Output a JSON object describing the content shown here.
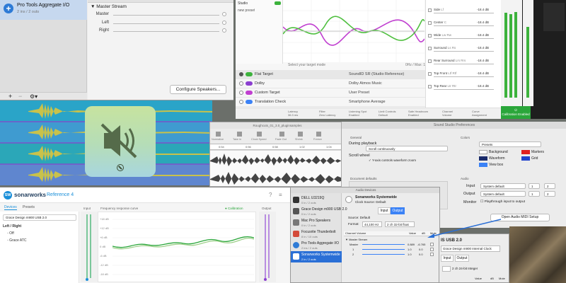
{
  "aggregate_io": {
    "device_name": "Pro Tools Aggregate I/O",
    "device_sub": "2 ins / 2 outs",
    "section": "Master Stream",
    "channels": [
      "Master",
      "Left",
      "Right"
    ],
    "configure_label": "Configure Speakers..."
  },
  "soundid": {
    "top_label": "Studio",
    "new_preset": "new preset",
    "select_mode": "Select your target mode",
    "range_label": "0Hz / Max: 100",
    "targets": [
      {
        "name": "Flat Target",
        "desc": "SoundID SR (Studio Reference)",
        "color": "#3cb23c"
      },
      {
        "name": "Dolby",
        "desc": "Dolby Atmos Music",
        "color": "#8b3fd0"
      },
      {
        "name": "Custom Target",
        "desc": "User Preset",
        "color": "#c03fd0"
      },
      {
        "name": "Translation Check",
        "desc": "Smartphone Average",
        "color": "#3b82f6"
      }
    ],
    "footer": [
      {
        "label": "Latency",
        "value": "36.3 ms"
      },
      {
        "label": "Filter",
        "value": "Zero Latency"
      },
      {
        "label": "Listening Spot",
        "value": "Enabled"
      },
      {
        "label": "Limit Controls",
        "value": "Default"
      },
      {
        "label": "Safe Headroom",
        "value": "Enabled"
      },
      {
        "label": "Channel",
        "value": "Volume"
      },
      {
        "label": "Curve",
        "value": "Assignment"
      }
    ],
    "channels": [
      {
        "name": "Side",
        "tag": "Lf",
        "value": "-18.4 dB"
      },
      {
        "name": "Center",
        "tag": "C",
        "value": "-18.4 dB"
      },
      {
        "name": "Wide",
        "tag": "Lw Rw",
        "value": "-18.4 dB"
      },
      {
        "name": "Surround",
        "tag": "Ls Rs",
        "value": "-18.4 dB"
      },
      {
        "name": "Rear Surround",
        "tag": "Lrs Rrs",
        "value": "-18.4 dB"
      },
      {
        "name": "Top Front",
        "tag": "Ltf Rtf",
        "value": "-18.4 dB"
      },
      {
        "name": "Top Rear",
        "tag": "Ltr Rtr",
        "value": "-18.4 dB"
      }
    ],
    "calibration": "Calibration Enabled"
  },
  "pro_tools": {
    "title": "Roughcuts_01_3.0_pluginsamples",
    "tools": [
      "Normalize",
      "Take in",
      "Clock Speed",
      "Fade Out",
      "Shrink",
      "Freeze"
    ],
    "ruler": [
      "0:54",
      "0:56",
      "0:58",
      "1:02",
      "1:04"
    ]
  },
  "preferences": {
    "title": "Sound Studio Preferences",
    "general": "General",
    "during_playback": "During playback",
    "scroll_option": "Scroll continuously",
    "scroll_wheel": "Scroll wheel",
    "zoom_check": "Y-axis controls waveform zoom",
    "document_defaults": "Document defaults",
    "colors": "Colors",
    "presets": "Presets",
    "swatches": [
      {
        "label": "Background",
        "color": "#ffffff"
      },
      {
        "label": "Markers",
        "color": "#e02020"
      },
      {
        "label": "Waveform",
        "color": "#1a2b6a"
      },
      {
        "label": "Grid",
        "color": "#2244cc"
      },
      {
        "label": "View box",
        "color": "#3b82f6"
      }
    ],
    "audio": "Audio",
    "input_label": "Input",
    "input_value": "System default",
    "output_label": "Output",
    "output_value": "System default",
    "monitor_label": "Monitor",
    "monitor_check": "Playthrough input to output",
    "ch1": "1",
    "ch2": "2",
    "midi_button": "Open Audio MIDI Setup"
  },
  "sonarworks": {
    "brand": "sonarworks",
    "product": "Reference 4",
    "tabs": [
      "Devices",
      "Presets"
    ],
    "device_select": "Grace Design m900 USB 2.0",
    "section": "Left / Right",
    "items": [
      "Off",
      "Grace ATC"
    ],
    "input_label": "Input",
    "plot_label": "Frequency response curve",
    "calibration": "Calibration",
    "output_label": "Output",
    "db_ticks": [
      "+18 dB",
      "+12 dB",
      "+6 dB",
      "0 dB",
      "-6 dB",
      "-12 dB",
      "-18 dB"
    ]
  },
  "audio_devices": {
    "title": "Audio Devices",
    "devices": [
      {
        "name": "DELL U3219Q",
        "sub": "0 in / 2 outs"
      },
      {
        "name": "Grace Design m900 USB 2.0",
        "sub": "0 in / 2 outs"
      },
      {
        "name": "Mac Pro Speakers",
        "sub": "0 in / 2 outs"
      },
      {
        "name": "Focusrite Thunderbolt",
        "sub": "8 in / 10 outs"
      },
      {
        "name": "Pro Tools Aggregate I/O",
        "sub": "2 ins / 2 outs"
      },
      {
        "name": "Sonarworks Systemwide",
        "sub": "2 in / 2 outs"
      }
    ],
    "selected_name": "Sonarworks Systemwide",
    "clock_source": "Clock Source:  Default",
    "tab_input": "Input",
    "tab_output": "Output",
    "source_line": "Source:  Default",
    "format_label": "Format:",
    "format_rate": "44,100 Hz",
    "format_bits": "2 ch 32-bit float",
    "col_headers": [
      "Channel Volume",
      "Value",
      "dB",
      "Mute"
    ],
    "master_stream": "Master Stream",
    "rows": [
      {
        "name": "Master",
        "value": "0.889",
        "db": "-6.765"
      },
      {
        "name": "1",
        "value": "1.0",
        "db": "0.0"
      },
      {
        "name": "2",
        "value": "1.0",
        "db": "0.0"
      }
    ]
  },
  "device_panel": {
    "name": "IS USB 2.0",
    "clock": "Grace Design m900 Internal Clock",
    "tab_input": "Input",
    "tab_output": "Output",
    "format": "2 ch 24-bit Integer",
    "col_value": "Value",
    "col_db": "dB",
    "col_mute": "Mute"
  }
}
